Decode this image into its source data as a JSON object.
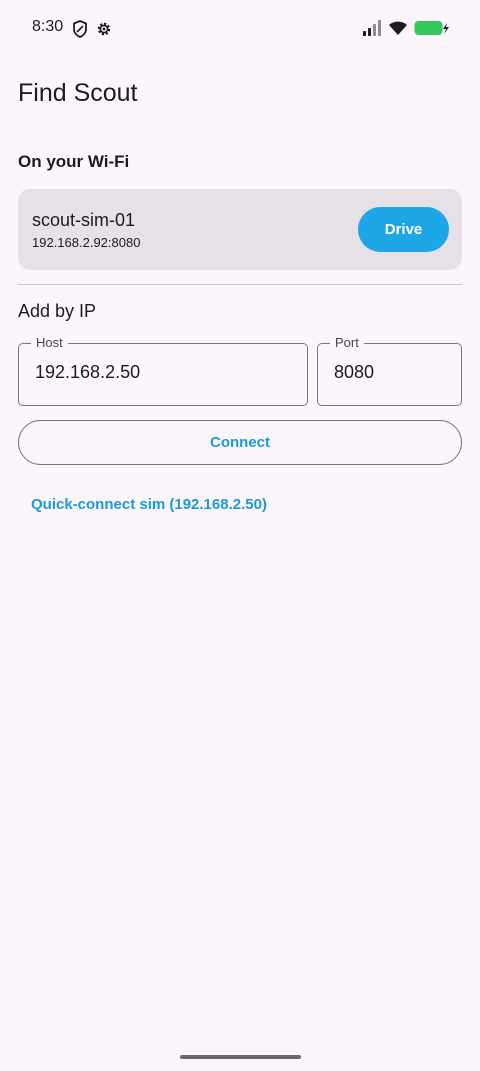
{
  "status_bar": {
    "time": "8:30",
    "icons_left": [
      "shield-icon",
      "gear-icon"
    ],
    "icons_right": [
      "signal-icon",
      "wifi-icon",
      "battery-charging-icon"
    ],
    "battery_color": "#34c759"
  },
  "page": {
    "title": "Find Scout"
  },
  "wifi_section": {
    "label": "On your Wi-Fi",
    "devices": [
      {
        "name": "scout-sim-01",
        "address": "192.168.2.92:8080",
        "action_label": "Drive"
      }
    ]
  },
  "add_by_ip": {
    "label": "Add by IP",
    "host": {
      "label": "Host",
      "value": "192.168.2.50"
    },
    "port": {
      "label": "Port",
      "value": "8080"
    },
    "connect_label": "Connect",
    "quick_connect_label": "Quick-connect sim (192.168.2.50)"
  },
  "colors": {
    "accent": "#1ea7e6",
    "link": "#1a9bd7",
    "background": "#fcf6fc",
    "card": "#e6e1e7"
  }
}
